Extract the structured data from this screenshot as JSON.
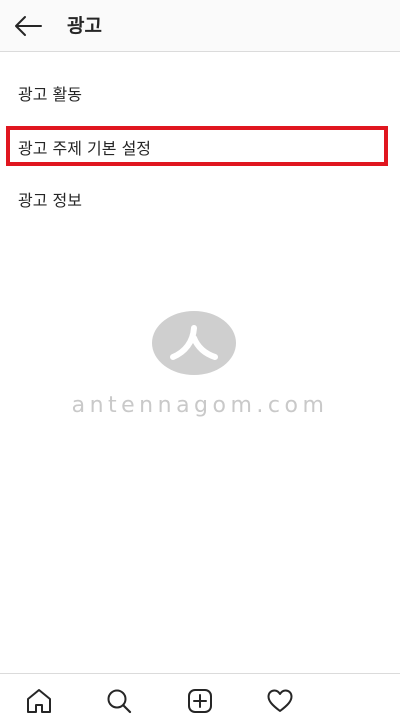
{
  "header": {
    "title": "광고",
    "back_icon": "arrow-left-icon"
  },
  "menu": {
    "items": [
      {
        "label": "광고 활동"
      },
      {
        "label": "광고 주제 기본 설정",
        "highlighted": true
      },
      {
        "label": "광고 정보"
      }
    ],
    "highlight_color": "#e0161f"
  },
  "watermark": {
    "text": "antennagom.com",
    "logo_icon": "antennagom-logo"
  },
  "tabbar": {
    "icons": [
      "home-icon",
      "search-icon",
      "add-post-icon",
      "heart-icon"
    ]
  }
}
